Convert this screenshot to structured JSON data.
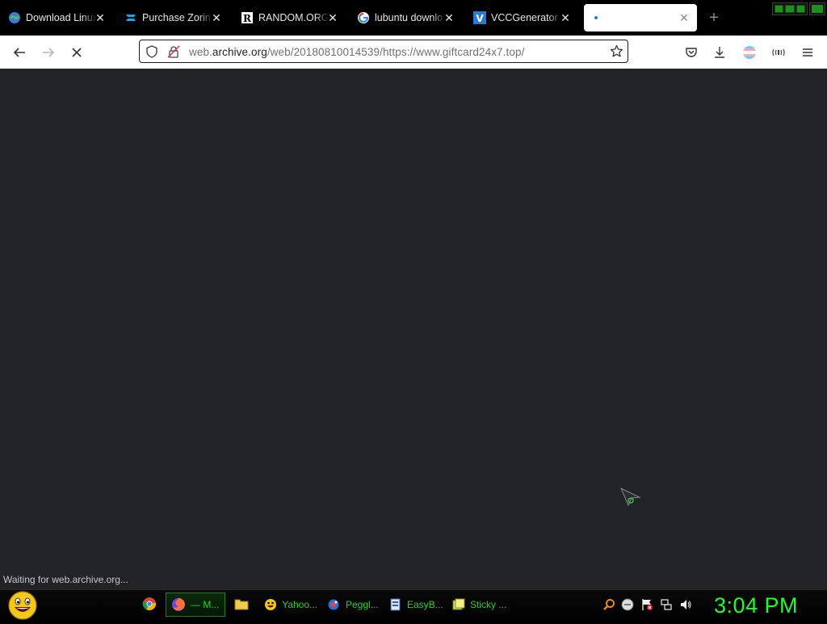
{
  "browser": {
    "tabs": [
      {
        "title": "Download Linux",
        "favicon": "globe-icon",
        "active": false
      },
      {
        "title": "Purchase Zorin",
        "favicon": "zorin-icon",
        "active": false
      },
      {
        "title": "RANDOM.ORG",
        "favicon": "random-org-icon",
        "active": false
      },
      {
        "title": "lubuntu downlo",
        "favicon": "google-icon",
        "active": false
      },
      {
        "title": "VCCGenerator -",
        "favicon": "vcc-icon",
        "active": false
      },
      {
        "title": "",
        "favicon": "loading-dot-icon",
        "active": true
      }
    ],
    "new_tab_label": "+",
    "close_glyph": "✕",
    "url": {
      "prefix": "web.",
      "domain": "archive.org",
      "path": "/web/20180810014539/https://www.giftcard24x7.top/"
    },
    "status": "Waiting for web.archive.org..."
  },
  "taskbar": {
    "items": [
      {
        "label": "— M...",
        "icon": "firefox-icon",
        "active": true
      },
      {
        "label": "Yahoo...",
        "icon": "yahoo-smiley-icon",
        "active": false
      },
      {
        "label": "Peggl...",
        "icon": "peggle-icon",
        "active": false
      },
      {
        "label": "EasyB...",
        "icon": "easyb-icon",
        "active": false
      },
      {
        "label": "Sticky ...",
        "icon": "sticky-notes-icon",
        "active": false
      }
    ],
    "clock": "3:04 PM"
  },
  "colors": {
    "content_bg": "#212327",
    "taskbar_text": "#2bd42b",
    "clock": "#22ff22"
  }
}
